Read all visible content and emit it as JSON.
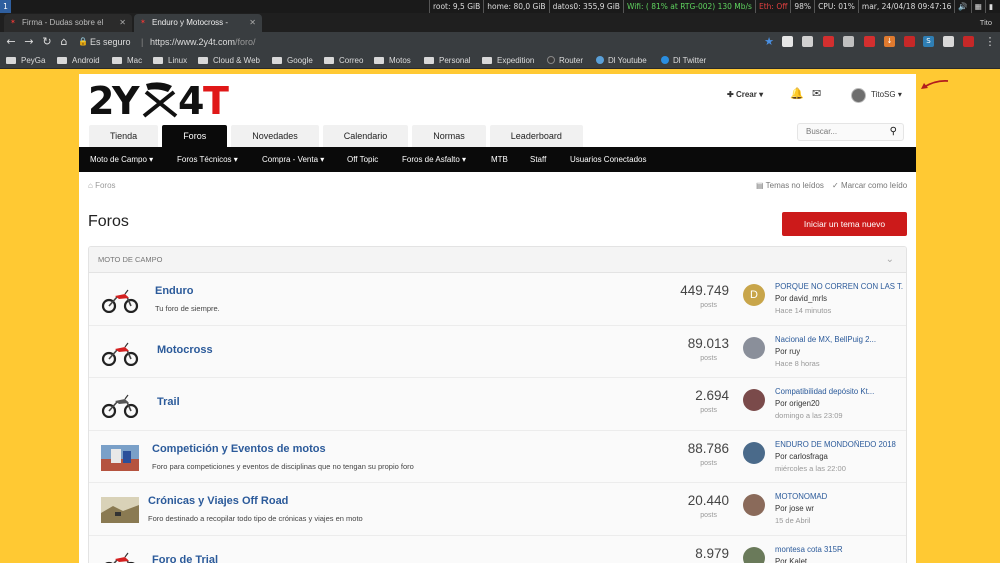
{
  "system_bar": {
    "workspace": "1",
    "root": "root: 9,5 GiB",
    "home": "home: 80,0 GiB",
    "datos": "datos0: 355,9 GiB",
    "wifi": "Wifi: ( 81% at RTG-002) 130 Mb/s",
    "eth": "Eth: Off",
    "battery": "98%",
    "cpu": "CPU: 01%",
    "datetime": "mar, 24/04/18  09:47:16"
  },
  "browser": {
    "tabs": [
      {
        "title": "Firma - Dudas sobre el"
      },
      {
        "title": "Enduro y Motocross - "
      }
    ],
    "profile": "Tito",
    "security": "Es seguro",
    "url_host": "https://www.2y4t.com",
    "url_path": "/foro/",
    "bookmarks": [
      "PeyGa",
      "Android",
      "Mac",
      "Linux",
      "Cloud & Web",
      "Google",
      "Correo",
      "Motos",
      "Personal",
      "Expedition",
      "Router",
      "Dl Youtube",
      "Dl Twitter"
    ]
  },
  "site": {
    "logo_text": "2Y4T",
    "crear": "Crear",
    "username": "TitoSG",
    "tabs": [
      "Tienda",
      "Foros",
      "Novedades",
      "Calendario",
      "Normas",
      "Leaderboard"
    ],
    "search_placeholder": "Buscar...",
    "subnav": [
      "Moto de Campo",
      "Foros Técnicos",
      "Compra - Venta",
      "Off Topic",
      "Foros de Asfalto",
      "MTB",
      "Staff",
      "Usuarios Conectados"
    ],
    "breadcrumb": "Foros",
    "unread_threads": "Temas no leídos",
    "mark_read": "Marcar como leído",
    "page_title": "Foros",
    "new_thread_button": "Iniciar un tema nuevo",
    "section_title": "MOTO DE CAMPO",
    "posts_label": "posts"
  },
  "forums": [
    {
      "name": "Enduro",
      "desc": "Tu foro de siempre.",
      "posts": "449.749",
      "last_title": "PORQUE NO CORREN CON LAS T...",
      "last_by": "Por david_mrls",
      "last_time": "Hace 14 minutos",
      "avatar_letter": "D",
      "avatar_color": "#c8a54a"
    },
    {
      "name": "Motocross",
      "desc": "",
      "posts": "89.013",
      "last_title": "Nacional de MX, BellPuig 2...",
      "last_by": "Por ruy",
      "last_time": "Hace 8 horas",
      "avatar_letter": "",
      "avatar_color": "#8a8f9a"
    },
    {
      "name": "Trail",
      "desc": "",
      "posts": "2.694",
      "last_title": "Compatibilidad depósito Kt...",
      "last_by": "Por origen20",
      "last_time": "domingo a las 23:09",
      "avatar_letter": "",
      "avatar_color": "#7a4a4a"
    },
    {
      "name": "Competición y Eventos de motos",
      "desc": "Foro para competiciones y eventos de disciplinas que no tengan su propio foro",
      "posts": "88.786",
      "last_title": "ENDURO DE MONDOÑEDO 2018",
      "last_by": "Por carlosfraga",
      "last_time": "miércoles a las 22:00",
      "avatar_letter": "",
      "avatar_color": "#4a6a8a"
    },
    {
      "name": "Crónicas y Viajes Off Road",
      "desc": "Foro destinado a recopilar todo tipo de crónicas y viajes en moto",
      "posts": "20.440",
      "last_title": "MOTONOMAD",
      "last_by": "Por jose wr",
      "last_time": "15 de Abril",
      "avatar_letter": "",
      "avatar_color": "#8a6a5a"
    },
    {
      "name": "Foro de Trial",
      "desc": "",
      "posts": "8.979",
      "last_title": "montesa cota 315R",
      "last_by": "Por Kalet",
      "last_time": "",
      "avatar_letter": "",
      "avatar_color": "#6a7a5a"
    }
  ],
  "colors": {
    "accent_red": "#cc1a1a",
    "link_blue": "#2b5a9a",
    "page_bg": "#ffc933"
  }
}
